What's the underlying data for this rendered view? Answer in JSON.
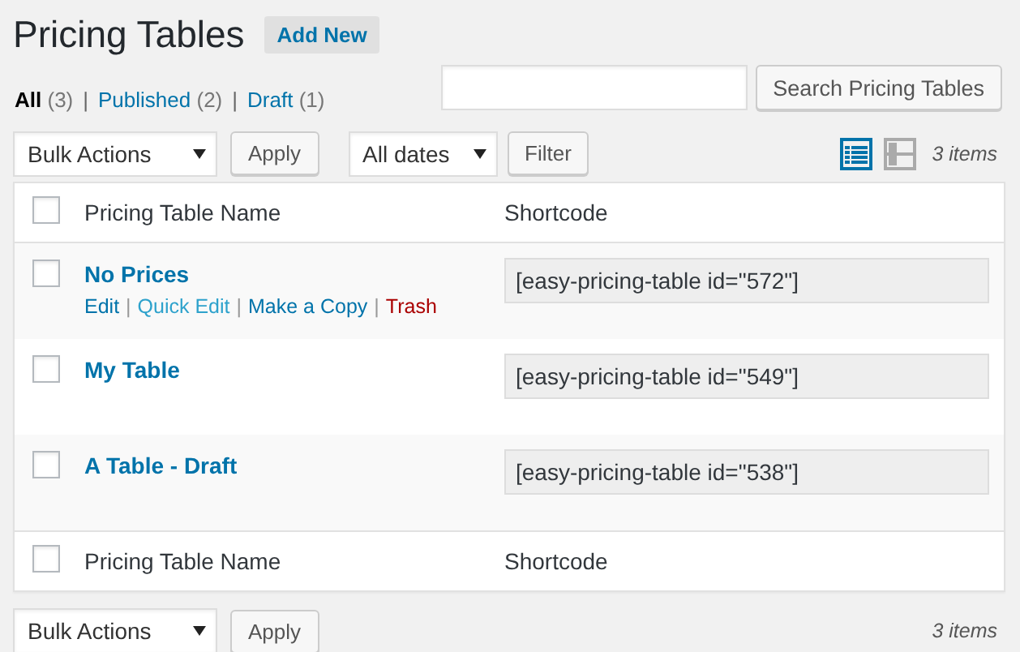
{
  "title": "Pricing Tables",
  "add_new": "Add New",
  "status_links": [
    {
      "label": "All",
      "count": "(3)",
      "selected": true,
      "separator": "|"
    },
    {
      "label": "Published",
      "count": "(2)",
      "selected": false,
      "separator": "|"
    },
    {
      "label": "Draft",
      "count": "(1)",
      "selected": false
    }
  ],
  "search": {
    "button": "Search Pricing Tables"
  },
  "top_nav": {
    "bulk_actions": "Bulk Actions",
    "apply": "Apply",
    "dates": "All dates",
    "filter": "Filter",
    "view_modes": [
      {
        "kind": "list",
        "selected": true
      },
      {
        "kind": "excerpt",
        "selected": false
      }
    ],
    "items": "3 items"
  },
  "table": {
    "columns": [
      "Pricing Table Name",
      "Shortcode"
    ],
    "select_all_checked": false,
    "footer_select_all_checked": false,
    "rows": [
      {
        "name": "No Prices",
        "checked": false,
        "shortcode": "[easy-pricing-table id=\"572\"]",
        "actions": [
          {
            "label": "Edit",
            "kind": "link",
            "separator": "|"
          },
          {
            "label": "Quick Edit",
            "kind": "hover",
            "separator": "|"
          },
          {
            "label": "Make a Copy",
            "kind": "link",
            "separator": "|"
          },
          {
            "label": "Trash",
            "kind": "delete"
          }
        ]
      },
      {
        "name": "My Table",
        "checked": false,
        "shortcode": "[easy-pricing-table id=\"549\"]"
      },
      {
        "name": "A Table - Draft",
        "checked": false,
        "shortcode": "[easy-pricing-table id=\"538\"]"
      }
    ],
    "footer_columns": [
      "Pricing Table Name",
      "Shortcode"
    ]
  },
  "bottom_nav": {
    "bulk_actions": "Bulk Actions",
    "apply": "Apply",
    "items": "3 items"
  }
}
